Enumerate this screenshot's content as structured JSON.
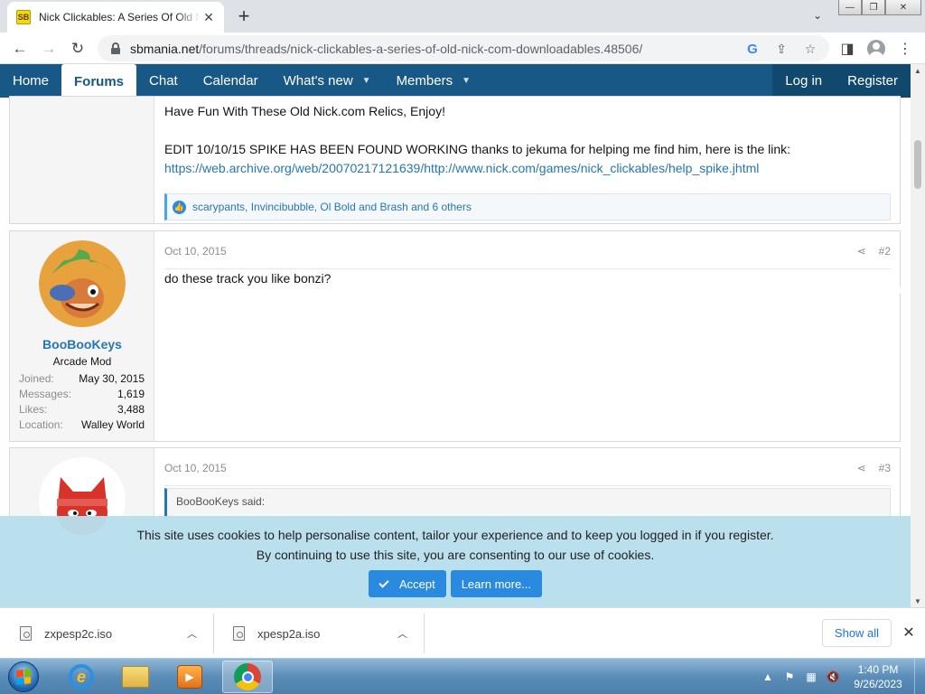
{
  "browser": {
    "tab_title": "Nick Clickables: A Series Of Old Nick.com Downloadables",
    "favicon_text": "SB",
    "url_host": "sbmania.net",
    "url_path": "/forums/threads/nick-clickables-a-series-of-old-nick-com-downloadables.48506/"
  },
  "nav": {
    "items": [
      {
        "label": "Home"
      },
      {
        "label": "Forums"
      },
      {
        "label": "Chat"
      },
      {
        "label": "Calendar"
      },
      {
        "label": "What's new"
      },
      {
        "label": "Members"
      }
    ],
    "login": "Log in",
    "register": "Register"
  },
  "post1": {
    "line1": "Have Fun With These Old Nick.com Relics, Enjoy!",
    "line2": "EDIT 10/10/15 SPIKE HAS BEEN FOUND WORKING thanks to jekuma for helping me find him, here is the link:",
    "link": "https://web.archive.org/web/20070217121639/http://www.nick.com/games/nick_clickables/help_spike.jhtml",
    "reactions": "scarypants, Invincibubble, Ol Bold and Brash and 6 others"
  },
  "post2": {
    "date": "Oct 10, 2015",
    "number": "#2",
    "username": "BooBooKeys",
    "user_title": "Arcade Mod",
    "stats": [
      {
        "key": "Joined:",
        "value": "May 30, 2015"
      },
      {
        "key": "Messages:",
        "value": "1,619"
      },
      {
        "key": "Likes:",
        "value": "3,488"
      },
      {
        "key": "Location:",
        "value": "Walley World"
      }
    ],
    "body": "do these track you like bonzi?"
  },
  "post3": {
    "date": "Oct 10, 2015",
    "number": "#3",
    "quote_attrib": "BooBooKeys said:"
  },
  "cookie": {
    "line1": "This site uses cookies to help personalise content, tailor your experience and to keep you logged in if you register.",
    "line2": "By continuing to use this site, you are consenting to our use of cookies.",
    "accept": "Accept",
    "learn_more": "Learn more..."
  },
  "downloads": {
    "items": [
      {
        "name": "zxpesp2c.iso"
      },
      {
        "name": "xpesp2a.iso"
      }
    ],
    "show_all": "Show all"
  },
  "taskbar": {
    "time": "1:40 PM",
    "date": "9/26/2023"
  },
  "colors": {
    "nav_bg": "#185886",
    "link": "#2577b1",
    "cookie_bg": "#b7deec",
    "accent_button": "#2a8ae0"
  }
}
